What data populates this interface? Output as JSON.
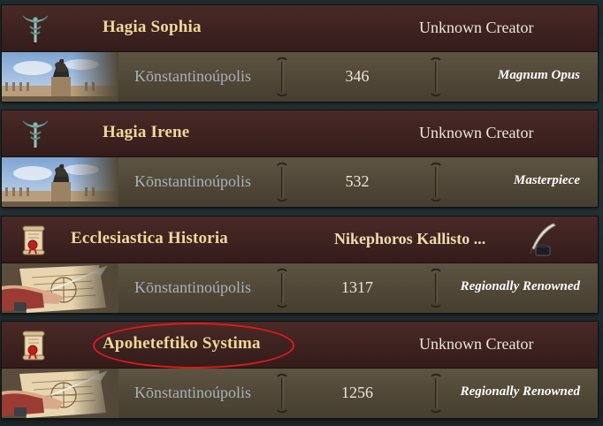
{
  "entries": [
    {
      "title": "Hagia Sophia",
      "creator": "Unknown Creator",
      "location": "Kōnstantinoúpolis",
      "value": "346",
      "rank": "Magnum Opus",
      "icon": "caduceus-icon",
      "thumbnail": "equestrian-statue-thumbnail"
    },
    {
      "title": "Hagia Irene",
      "creator": "Unknown Creator",
      "location": "Kōnstantinoúpolis",
      "value": "532",
      "rank": "Masterpiece",
      "icon": "caduceus-icon",
      "thumbnail": "equestrian-statue-thumbnail"
    },
    {
      "title": "Ecclesiastica Historia",
      "creator": "Nikephoros Kallisto ...",
      "location": "Kōnstantinoúpolis",
      "value": "1317",
      "rank": "Regionally Renowned",
      "icon": "scroll-seal-icon",
      "thumbnail": "writing-hand-thumbnail",
      "creator_icon": "quill-inkwell-icon"
    },
    {
      "title": "Apoheteftiko Systima",
      "creator": "Unknown Creator",
      "location": "Kōnstantinoúpolis",
      "value": "1256",
      "rank": "Regionally Renowned",
      "icon": "scroll-seal-icon",
      "thumbnail": "writing-hand-thumbnail",
      "highlighted": true
    }
  ],
  "colors": {
    "header_bg": "#3d2220",
    "body_bg": "#514838",
    "title_text": "#f0d89a",
    "location_text": "#a9b1ba",
    "highlight_ring": "#e01a1a"
  }
}
